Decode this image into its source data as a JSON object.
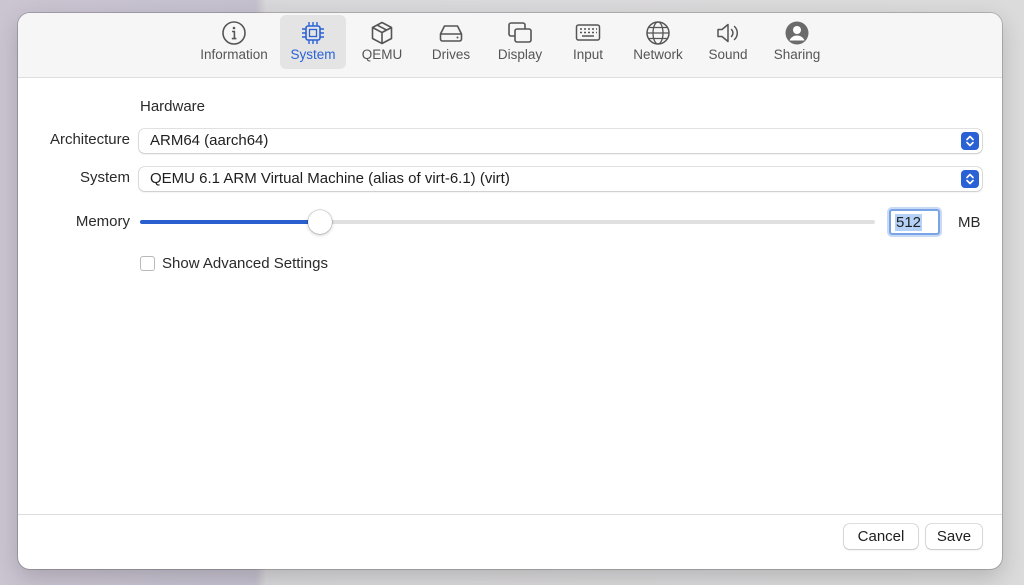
{
  "tabs": [
    {
      "label": "Information",
      "icon": "info-circle-icon"
    },
    {
      "label": "System",
      "icon": "cpu-chip-icon"
    },
    {
      "label": "QEMU",
      "icon": "cube-icon"
    },
    {
      "label": "Drives",
      "icon": "drive-icon"
    },
    {
      "label": "Display",
      "icon": "display-windows-icon"
    },
    {
      "label": "Input",
      "icon": "keyboard-icon"
    },
    {
      "label": "Network",
      "icon": "globe-icon"
    },
    {
      "label": "Sound",
      "icon": "speaker-icon"
    },
    {
      "label": "Sharing",
      "icon": "person-circle-icon"
    }
  ],
  "selected_tab": "System",
  "hardware": {
    "section_title": "Hardware",
    "architecture_label": "Architecture",
    "architecture_value": "ARM64 (aarch64)",
    "system_label": "System",
    "system_value": "QEMU 6.1 ARM Virtual Machine (alias of virt-6.1) (virt)",
    "memory_label": "Memory",
    "memory_value": "512",
    "memory_unit": "MB",
    "memory_slider_fraction": 0.245,
    "advanced_label": "Show Advanced Settings",
    "advanced_checked": false
  },
  "footer": {
    "cancel_label": "Cancel",
    "save_label": "Save"
  },
  "colors": {
    "accent": "#2a62d6",
    "selection": "#b5d1f7"
  }
}
